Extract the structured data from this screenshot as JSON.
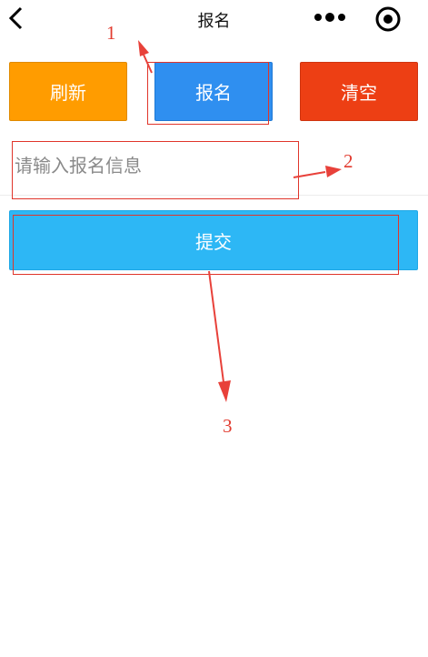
{
  "navbar": {
    "title": "报名",
    "back_icon": "back-icon",
    "more_icon": "more-dots-icon",
    "capsule_icon": "capsule-close-icon"
  },
  "actions": {
    "refresh_label": "刷新",
    "signup_label": "报名",
    "clear_label": "清空"
  },
  "form": {
    "input_placeholder": "请输入报名信息",
    "input_value": "",
    "submit_label": "提交"
  },
  "annotations": [
    "1",
    "2",
    "3"
  ],
  "colors": {
    "refresh": "#ff9c00",
    "signup": "#2f8ff0",
    "clear": "#ed3f14",
    "submit": "#2db7f5",
    "annotation": "#e0352b"
  }
}
